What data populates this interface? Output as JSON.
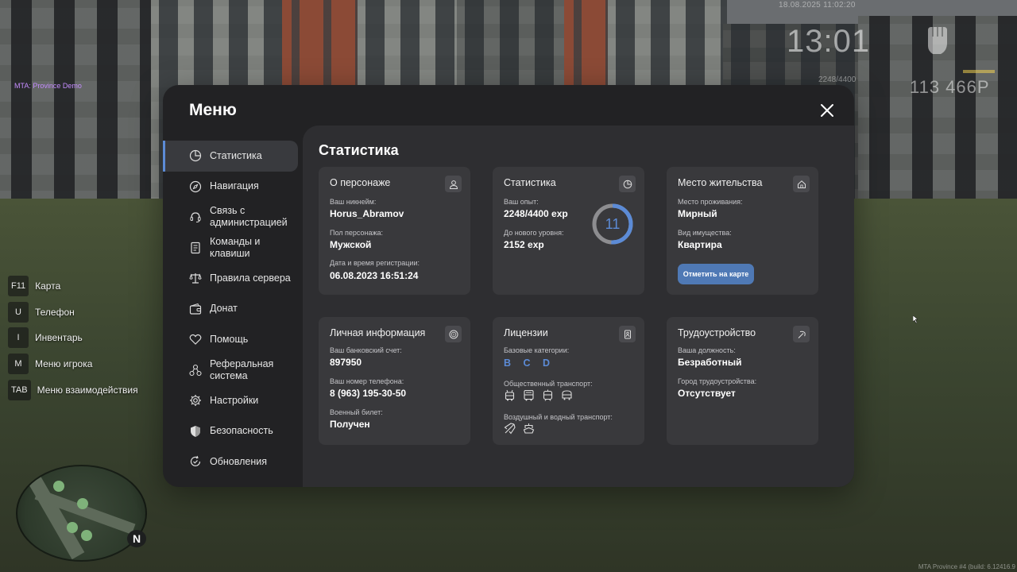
{
  "hud": {
    "server_label": "MTA: Province Demo",
    "datetime": "18.08.2025 11:02:20",
    "time": "13:01",
    "exp": "2248/4400",
    "money": "113 466Р",
    "build_info": "MTA Province #4 (build: 6.12416.9"
  },
  "keybinds": [
    {
      "key": "F11",
      "label": "Карта"
    },
    {
      "key": "U",
      "label": "Телефон"
    },
    {
      "key": "I",
      "label": "Инвентарь"
    },
    {
      "key": "M",
      "label": "Меню игрока"
    },
    {
      "key": "TAB",
      "label": "Меню взаимодействия"
    }
  ],
  "minimap": {
    "north_label": "N"
  },
  "menu": {
    "title": "Меню",
    "sidebar": [
      {
        "label": "Статистика",
        "icon": "stats-icon",
        "active": true
      },
      {
        "label": "Навигация",
        "icon": "compass-icon"
      },
      {
        "label": "Связь с администрацией",
        "icon": "headset-icon"
      },
      {
        "label": "Команды и клавиши",
        "icon": "commands-icon"
      },
      {
        "label": "Правила сервера",
        "icon": "scales-icon"
      },
      {
        "label": "Донат",
        "icon": "wallet-icon"
      },
      {
        "label": "Помощь",
        "icon": "heart-hand-icon"
      },
      {
        "label": "Реферальная система",
        "icon": "referral-icon"
      },
      {
        "label": "Настройки",
        "icon": "gear-icon"
      },
      {
        "label": "Безопасность",
        "icon": "shield-icon"
      },
      {
        "label": "Обновления",
        "icon": "update-icon"
      }
    ],
    "content_title": "Статистика",
    "cards": {
      "character": {
        "title": "О персонаже",
        "nickname_label": "Ваш никнейм:",
        "nickname": "Horus_Abramov",
        "gender_label": "Пол персонажа:",
        "gender": "Мужской",
        "reg_label": "Дата и время регистрации:",
        "reg": "06.08.2023 16:51:24"
      },
      "stats": {
        "title": "Статистика",
        "exp_label": "Ваш опыт:",
        "exp": "2248/4400 exp",
        "next_label": "До нового уровня:",
        "next": "2152 exp",
        "level": "11",
        "progress": 0.511
      },
      "residence": {
        "title": "Место жительства",
        "place_label": "Место проживания:",
        "place": "Мирный",
        "property_label": "Вид имущества:",
        "property": "Квартира",
        "map_button": "Отметить на карте"
      },
      "personal": {
        "title": "Личная информация",
        "bank_label": "Ваш банковский счет:",
        "bank": "897950",
        "phone_label": "Ваш номер телефона:",
        "phone": "8 (963) 195-30-50",
        "military_label": "Военный билет:",
        "military": "Получен"
      },
      "licenses": {
        "title": "Лицензии",
        "base_label": "Базовые категории:",
        "base": "B C D",
        "public_label": "Общественный транспорт:",
        "public_icons": [
          "trolleybus-icon",
          "bus-icon",
          "tram-icon",
          "minibus-icon"
        ],
        "air_label": "Воздушный и водный транспорт:",
        "air_icons": [
          "plane-icon",
          "boat-icon"
        ]
      },
      "employment": {
        "title": "Трудоустройство",
        "position_label": "Ваша должность:",
        "position": "Безработный",
        "city_label": "Город трудоустройства:",
        "city": "Отсутствует"
      }
    }
  },
  "colors": {
    "accent": "#5c8bd6",
    "button": "#4f79b5",
    "panel": "#222224",
    "content": "#2e2e31",
    "card": "#39393c"
  }
}
